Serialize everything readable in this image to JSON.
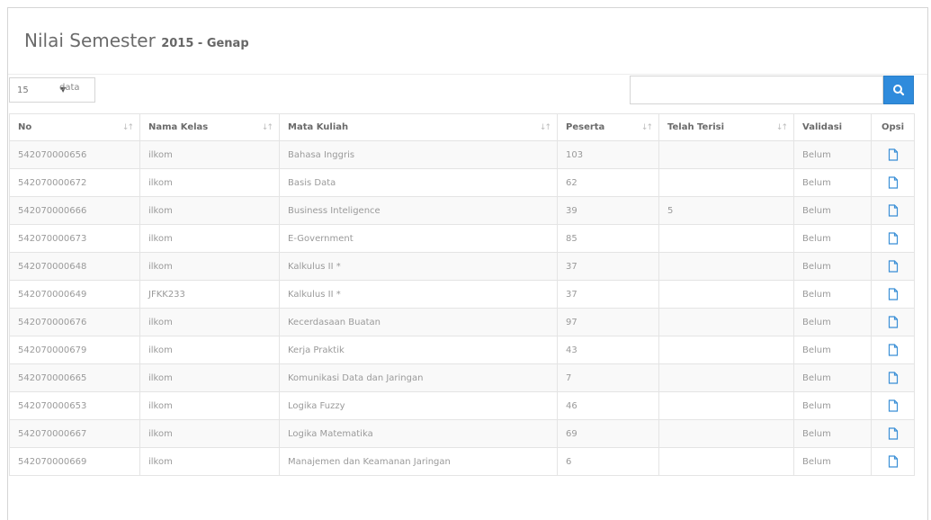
{
  "page": {
    "title": "Nilai Semester",
    "subtitle": "2015 - Genap"
  },
  "length_menu": {
    "selected": "15",
    "suffix": "data"
  },
  "search": {
    "value": "",
    "placeholder": "",
    "icon": "search-icon"
  },
  "table": {
    "columns": [
      "No",
      "Nama Kelas",
      "Mata Kuliah",
      "Peserta",
      "Telah Terisi",
      "Validasi",
      "Opsi"
    ],
    "rows": [
      {
        "no": "542070000656",
        "kelas": "ilkom",
        "matkul": "Bahasa Inggris",
        "peserta": "103",
        "terisi": "",
        "validasi": "Belum"
      },
      {
        "no": "542070000672",
        "kelas": "ilkom",
        "matkul": "Basis Data",
        "peserta": "62",
        "terisi": "",
        "validasi": "Belum"
      },
      {
        "no": "542070000666",
        "kelas": "ilkom",
        "matkul": "Business Inteligence",
        "peserta": "39",
        "terisi": "5",
        "validasi": "Belum"
      },
      {
        "no": "542070000673",
        "kelas": "ilkom",
        "matkul": "E-Government",
        "peserta": "85",
        "terisi": "",
        "validasi": "Belum"
      },
      {
        "no": "542070000648",
        "kelas": "ilkom",
        "matkul": "Kalkulus II *",
        "peserta": "37",
        "terisi": "",
        "validasi": "Belum"
      },
      {
        "no": "542070000649",
        "kelas": "JFKK233",
        "matkul": "Kalkulus II *",
        "peserta": "37",
        "terisi": "",
        "validasi": "Belum"
      },
      {
        "no": "542070000676",
        "kelas": "ilkom",
        "matkul": "Kecerdasaan Buatan",
        "peserta": "97",
        "terisi": "",
        "validasi": "Belum"
      },
      {
        "no": "542070000679",
        "kelas": "ilkom",
        "matkul": "Kerja Praktik",
        "peserta": "43",
        "terisi": "",
        "validasi": "Belum"
      },
      {
        "no": "542070000665",
        "kelas": "ilkom",
        "matkul": "Komunikasi Data dan Jaringan",
        "peserta": "7",
        "terisi": "",
        "validasi": "Belum"
      },
      {
        "no": "542070000653",
        "kelas": "ilkom",
        "matkul": "Logika Fuzzy",
        "peserta": "46",
        "terisi": "",
        "validasi": "Belum"
      },
      {
        "no": "542070000667",
        "kelas": "ilkom",
        "matkul": "Logika Matematika",
        "peserta": "69",
        "terisi": "",
        "validasi": "Belum"
      },
      {
        "no": "542070000669",
        "kelas": "ilkom",
        "matkul": "Manajemen dan Keamanan Jaringan",
        "peserta": "6",
        "terisi": "",
        "validasi": "Belum"
      }
    ],
    "opsi_icon": "edit-document-icon"
  },
  "colors": {
    "accent": "#2f8bdc",
    "icon": "#3a8fd6"
  }
}
